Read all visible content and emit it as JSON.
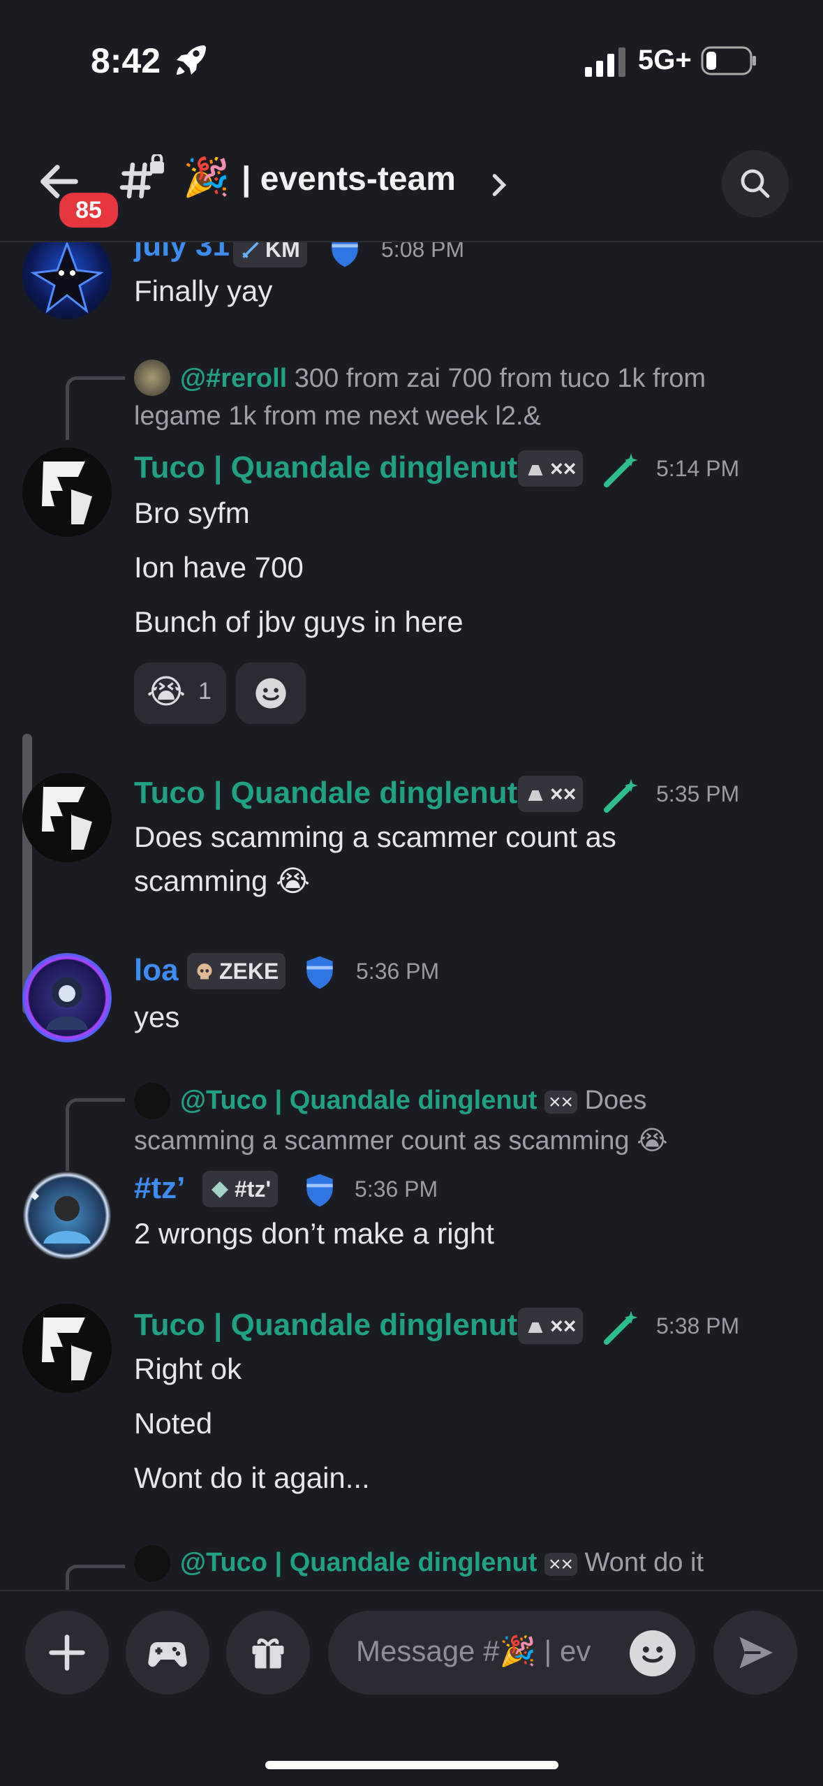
{
  "status": {
    "time": "8:42",
    "network": "5G+"
  },
  "header": {
    "unread_badge": "85",
    "channel_emoji": "🎉",
    "channel_name": "| events-team"
  },
  "messages": [
    {
      "author": "july 31",
      "tag": "KM",
      "time": "5:08 PM",
      "lines": [
        "Finally yay"
      ]
    },
    {
      "reply": {
        "mention": "@#reroll",
        "text1": "300 from zai 700 from tuco 1k from",
        "text2": "legame 1k from me next week l2.&"
      },
      "author": "Tuco | Quandale dinglenut",
      "tag": "××",
      "time": "5:14 PM",
      "lines": [
        "Bro syfm",
        "Ion have 700",
        "Bunch of jbv guys in here"
      ],
      "reactions": [
        {
          "emoji": "😭",
          "count": "1"
        }
      ]
    },
    {
      "author": "Tuco | Quandale dinglenut",
      "tag": "××",
      "time": "5:35 PM",
      "lines": [
        "Does scamming a scammer count as",
        "scamming 😭"
      ]
    },
    {
      "author": "loa",
      "tag": "ZEKE",
      "time": "5:36 PM",
      "lines": [
        "yes"
      ]
    },
    {
      "reply": {
        "mention": "@Tuco | Quandale dinglenut",
        "tag": "××",
        "text1": "Does",
        "text2": "scamming a scammer count as scamming 😭"
      },
      "author": "#tz’",
      "tag": "#tz'",
      "time": "5:36 PM",
      "lines": [
        "2 wrongs don’t make a right"
      ]
    },
    {
      "author": "Tuco | Quandale dinglenut",
      "tag": "××",
      "time": "5:38 PM",
      "lines": [
        "Right ok",
        "Noted",
        "Wont do it again..."
      ]
    },
    {
      "reply": {
        "mention": "@Tuco | Quandale dinglenut",
        "tag": "××",
        "text1": "Wont do it"
      }
    }
  ],
  "composer": {
    "placeholder": "Message #🎉 | ev"
  },
  "icons": {
    "back": "arrow-left-icon",
    "channel": "locked-text-channel-icon",
    "search": "search-icon",
    "add": "plus-icon",
    "games": "gamepad-icon",
    "gift": "gift-icon",
    "emoji": "smiley-icon",
    "send": "send-icon"
  },
  "colors": {
    "background": "#1b1c21",
    "teal_name": "#21a184",
    "blue_name": "#3d8df0",
    "badge": "#e5373d"
  }
}
